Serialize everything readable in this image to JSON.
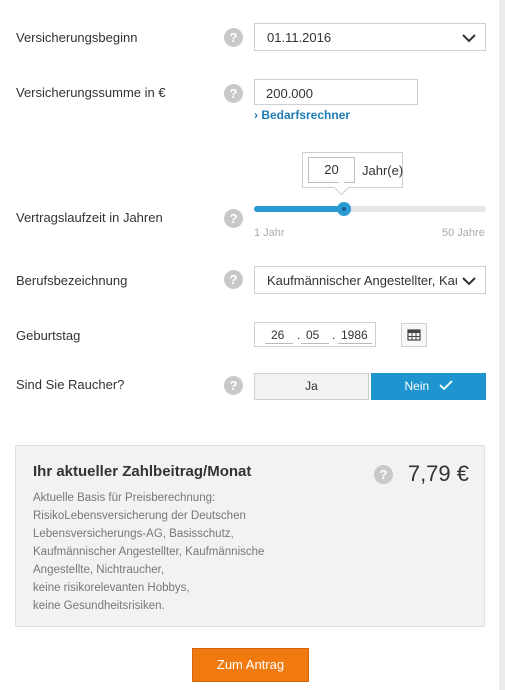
{
  "rows": {
    "start": {
      "label": "Versicherungsbeginn",
      "help": "?",
      "value": "01.11.2016"
    },
    "sum": {
      "label": "Versicherungssumme in €",
      "help": "?",
      "value": "200.000",
      "link": "› Bedarfsrechner"
    },
    "term": {
      "label": "Vertragslaufzeit in Jahren",
      "help": "?",
      "value": "20",
      "unit": "Jahr(e)",
      "min_label": "1 Jahr",
      "max_label": "50 Jahre",
      "min": 1,
      "max": 50,
      "current": 20
    },
    "job": {
      "label": "Berufsbezeichnung",
      "help": "?",
      "value": "Kaufmännischer Angestellter, Kaufm"
    },
    "birthday": {
      "label": "Geburtstag",
      "day": "26",
      "month": "05",
      "year": "1986",
      "sep": "."
    },
    "smoker": {
      "label": "Sind Sie Raucher?",
      "help": "?",
      "yes": "Ja",
      "no": "Nein",
      "selected": "no"
    }
  },
  "summary": {
    "title": "Ihr aktueller Zahlbeitrag/Monat",
    "help": "?",
    "price": "7,79 €",
    "description": [
      "Aktuelle Basis für Preisberechnung:",
      "RisikoLebensversicherung der Deutschen",
      "Lebensversicherungs-AG, Basisschutz,",
      "Kaufmännischer Angestellter, Kaufmännische",
      "Angestellte, Nichtraucher,",
      "keine risikorelevanten Hobbys,",
      "keine Gesundheitsrisiken."
    ]
  },
  "cta": {
    "label": "Zum Antrag"
  },
  "colors": {
    "accent": "#1f95d0",
    "cta": "#f07a10",
    "link": "#1e7cb5"
  }
}
